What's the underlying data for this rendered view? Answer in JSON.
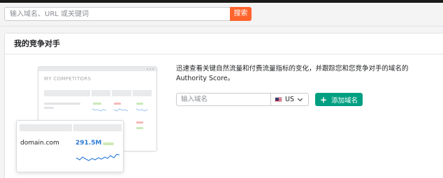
{
  "search": {
    "placeholder": "输入域名、URL 或关键词",
    "button_label": "搜索"
  },
  "card": {
    "title": "我的竞争对手",
    "description": "迅速查看关键自然流量和付费流量指标的变化，并跟踪您和您竞争对手的域名的 Authority Score。",
    "domain_placeholder": "输入域名",
    "country": "US",
    "add_button_label": "添加域名"
  },
  "illustration": {
    "title": "MY COMPETITORS",
    "domain": "domain.com",
    "value": "291.5M"
  },
  "colors": {
    "accent_orange": "#ff642d",
    "accent_green": "#009f81",
    "value_blue": "#2b7bd6"
  }
}
